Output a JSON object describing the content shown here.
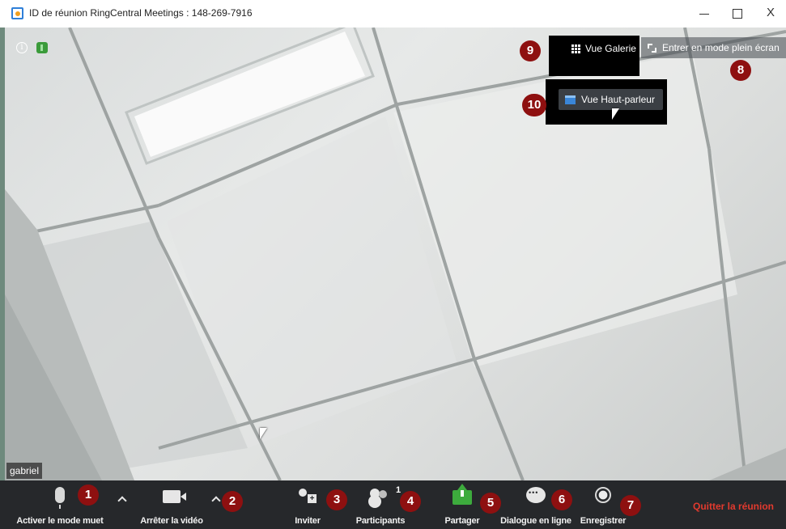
{
  "window": {
    "title": "ID de réunion RingCentral Meetings : 148-269-7916",
    "close_glyph": "X"
  },
  "video": {
    "info_glyph": "i",
    "participant_name": "gabriel"
  },
  "view_controls": {
    "gallery_label": "Vue Galerie",
    "speaker_label": "Vue Haut-parleur",
    "fullscreen_label": "Entrer en mode plein écran"
  },
  "badges": [
    "1",
    "2",
    "3",
    "4",
    "5",
    "6",
    "7",
    "8",
    "9",
    "10"
  ],
  "toolbar": {
    "mute_label": "Activer le mode muet",
    "video_label": "Arrêter la vidéo",
    "invite_label": "Inviter",
    "participants_label": "Participants",
    "participants_count": "1",
    "share_label": "Partager",
    "chat_label": "Dialogue en ligne",
    "record_label": "Enregistrer",
    "quit_label": "Quitter la réunion"
  },
  "colors": {
    "badge": "#8e1010",
    "toolbar_bg": "#26282b",
    "quit_text": "#e23a2e",
    "share_green": "#3dab3d",
    "speaker_blue": "#3a86d8"
  },
  "icons": [
    "app-icon",
    "info-icon",
    "signal-icon",
    "grid-icon",
    "speaker-view-icon",
    "fullscreen-icon",
    "microphone-icon",
    "camera-icon",
    "invite-icon",
    "participants-icon",
    "share-icon",
    "chat-icon",
    "record-icon",
    "chevron-up-icon",
    "cursor-icon"
  ]
}
